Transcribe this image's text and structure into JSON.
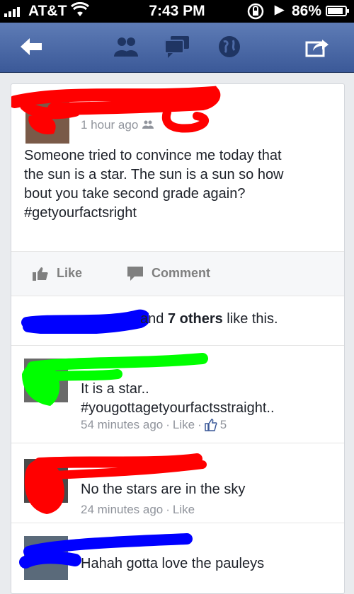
{
  "status_bar": {
    "carrier": "AT&T",
    "time": "7:43 PM",
    "battery": "86%",
    "battery_level": 0.86
  },
  "nav": {
    "icons": [
      "back-arrow-icon",
      "friends-icon",
      "messages-icon",
      "globe-icon",
      "share-icon"
    ]
  },
  "post": {
    "time": "1 hour ago",
    "lines": [
      "Someone tried to convince me today that",
      "the sun is a star. The sun is a sun so how",
      "bout you take second grade again?",
      "#getyourfactsright"
    ],
    "like_label": "Like",
    "comment_label": "Comment"
  },
  "likes_summary": {
    "prefix": "and ",
    "count": "7 others",
    "suffix": " like this."
  },
  "comments": [
    {
      "lines": [
        "It is a star..",
        "#yougottagetyourfactsstraight.."
      ],
      "time": "54 minutes ago",
      "like": "Like",
      "likes_count": "5"
    },
    {
      "lines": [
        "No the stars are in the sky"
      ],
      "time": "24 minutes ago",
      "like": "Like"
    },
    {
      "lines": [
        "Hahah gotta love the pauleys"
      ]
    }
  ],
  "colors": {
    "facebook_blue": "#3b5998",
    "scribble_red": "#ff0000",
    "scribble_blue": "#0000ff",
    "scribble_green": "#00ff00"
  }
}
